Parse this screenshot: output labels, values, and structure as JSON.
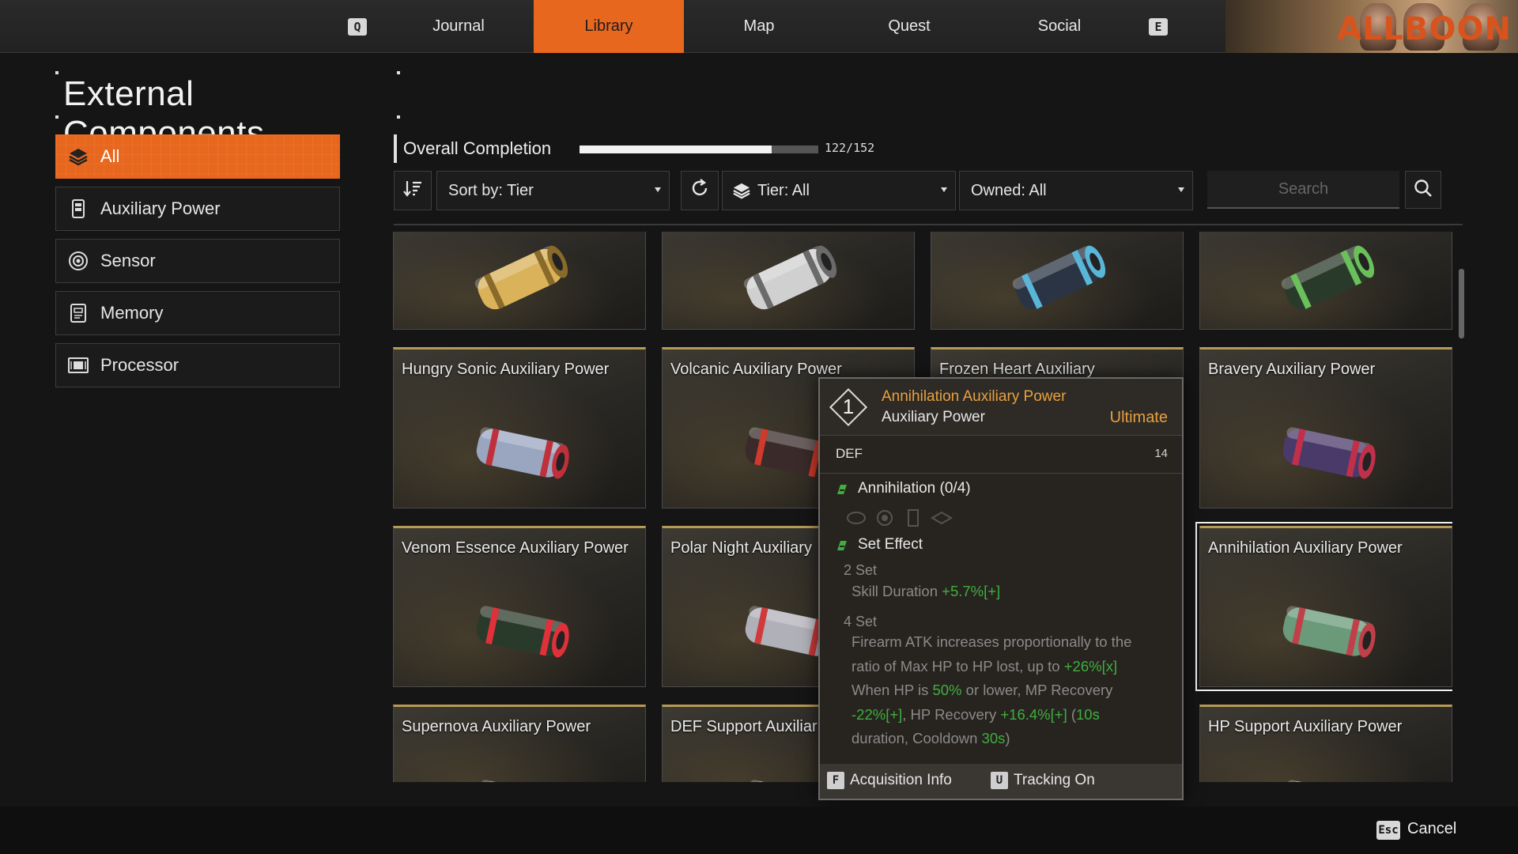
{
  "nav": {
    "prev_key": "Q",
    "next_key": "E",
    "tabs": [
      {
        "label": "Journal",
        "active": false
      },
      {
        "label": "Library",
        "active": true
      },
      {
        "label": "Map",
        "active": false
      },
      {
        "label": "Quest",
        "active": false
      },
      {
        "label": "Social",
        "active": false
      }
    ],
    "banner_text": "ALLBOON"
  },
  "page_title": "External Components",
  "categories": [
    {
      "label": "All",
      "icon": "layers-icon",
      "active": true
    },
    {
      "label": "Auxiliary Power",
      "icon": "battery-icon",
      "active": false
    },
    {
      "label": "Sensor",
      "icon": "sensor-icon",
      "active": false
    },
    {
      "label": "Memory",
      "icon": "memory-icon",
      "active": false
    },
    {
      "label": "Processor",
      "icon": "processor-icon",
      "active": false
    }
  ],
  "completion": {
    "label": "Overall Completion",
    "text": "122/152",
    "fraction": 0.803
  },
  "filters": {
    "sort_label": "Sort by: Tier",
    "tier_label": "Tier: All",
    "owned_label": "Owned: All",
    "search_placeholder": "Search"
  },
  "cards": [
    {
      "name": "",
      "tint": "gold"
    },
    {
      "name": "",
      "tint": "silver"
    },
    {
      "name": "",
      "tint": "blue"
    },
    {
      "name": "",
      "tint": "green"
    },
    {
      "name": "Hungry Sonic Auxiliary Power",
      "tint": "blue-red"
    },
    {
      "name": "Volcanic Auxiliary Power",
      "tint": "red"
    },
    {
      "name": "Frozen Heart Auxiliary",
      "tint": "ice"
    },
    {
      "name": "Bravery Auxiliary Power",
      "tint": "purple"
    },
    {
      "name": "Venom Essence Auxiliary Power",
      "tint": "green-red"
    },
    {
      "name": "Polar Night Auxiliary",
      "tint": "red-silver"
    },
    {
      "name": "",
      "tint": "none"
    },
    {
      "name": "Annihilation Auxiliary Power",
      "tint": "green-silver"
    },
    {
      "name": "Supernova Auxiliary Power",
      "tint": "gold"
    },
    {
      "name": "DEF Support Auxiliar Power",
      "tint": "silver"
    },
    {
      "name": "",
      "tint": "none"
    },
    {
      "name": "HP Support Auxiliary Power",
      "tint": "red-silver"
    }
  ],
  "tooltip": {
    "tier": "1",
    "title": "Annihilation Auxiliary Power",
    "type": "Auxiliary Power",
    "grade": "Ultimate",
    "stat_label": "DEF",
    "stat_value": "14",
    "set_name": "Annihilation (0/4)",
    "set_effect_label": "Set Effect",
    "set2_label": "2 Set",
    "set2_text": "Skill Duration",
    "set2_value": "+5.7%[+]",
    "set4_label": "4 Set",
    "set4_line1": "Firearm ATK increases proportionally to the",
    "set4_line2a": "ratio of Max HP to HP lost, up to",
    "set4_line2b": "+26%[x]",
    "set4_line3a": "When HP is",
    "set4_line3b": "50%",
    "set4_line3c": "or lower, MP Recovery",
    "set4_line4a": "-22%[+]",
    "set4_line4b": ", HP Recovery",
    "set4_line4c": "+16.4%[+]",
    "set4_line4d": "(",
    "set4_line4e": "10s",
    "set4_line5a": "duration, Cooldown",
    "set4_line5b": "30s",
    "set4_line5c": ")",
    "foot_key1": "F",
    "foot_label1": "Acquisition Info",
    "foot_key2": "U",
    "foot_label2": "Tracking On"
  },
  "footer": {
    "esc_key": "Esc",
    "cancel_label": "Cancel"
  },
  "colors": {
    "accent": "#e8671e",
    "tooltip_title": "#e8a040",
    "positive": "#3fae3f"
  }
}
